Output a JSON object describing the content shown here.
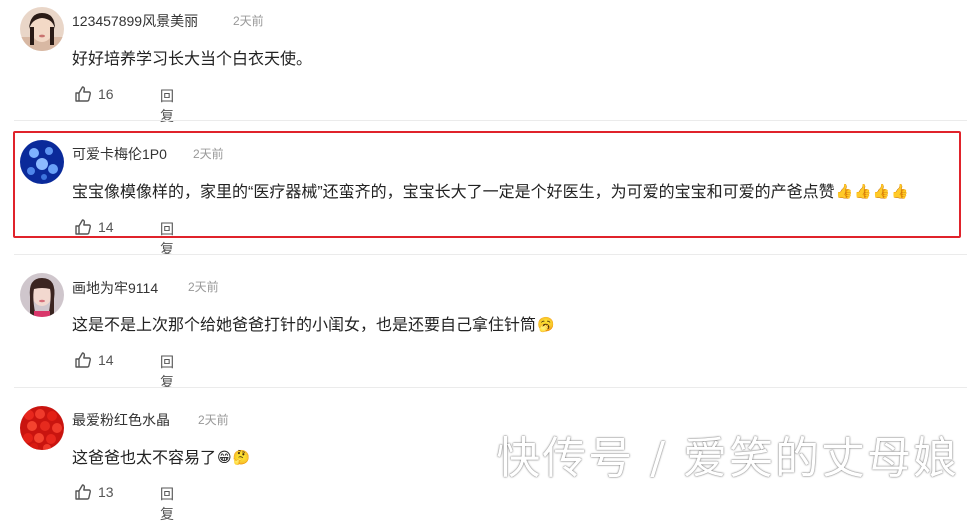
{
  "comments": [
    {
      "username": "123457899风景美丽",
      "time": "2天前",
      "text": "好好培养学习长大当个白衣天使。",
      "likes": "16",
      "reply": "回复",
      "avatar": "person-photo"
    },
    {
      "username": "可爱卡梅伦1P0",
      "time": "2天前",
      "text": "宝宝像模像样的，家里的“医疗器械”还蛮齐的，宝宝长大了一定是个好医生，为可爱的宝宝和可爱的产爸点赞",
      "emojis": [
        "👍",
        "👍",
        "👍",
        "👍"
      ],
      "likes": "14",
      "reply": "回复",
      "avatar": "blue-droplets",
      "highlighted": true
    },
    {
      "username": "画地为牢9114",
      "time": "2天前",
      "text": "这是不是上次那个给她爸爸打针的小闺女，也是还要自己拿住针筒",
      "emojis": [
        "🥱"
      ],
      "likes": "14",
      "reply": "回复",
      "avatar": "woman-photo"
    },
    {
      "username": "最爱粉红色水晶",
      "time": "2天前",
      "text": "这爸爸也太不容易了",
      "emojis": [
        "😁",
        "🤔"
      ],
      "likes": "13",
      "reply": "回复",
      "avatar": "red-beads"
    }
  ],
  "watermark": "快传号 / 爱笑的丈母娘",
  "highlight_color": "#e0232b"
}
